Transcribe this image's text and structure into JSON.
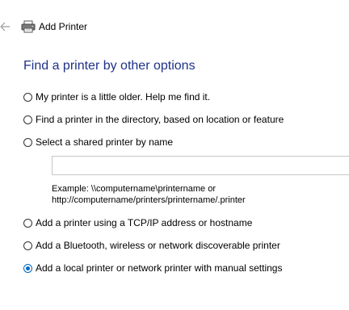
{
  "window": {
    "title": "Add Printer"
  },
  "icons": {
    "back": "back-arrow-icon",
    "printer": "printer-icon"
  },
  "colors": {
    "heading": "#1e3287",
    "radio_selected": "#0067c0"
  },
  "main": {
    "heading": "Find a printer by other options",
    "options": [
      {
        "label": "My printer is a little older. Help me find it.",
        "selected": false
      },
      {
        "label": "Find a printer in the directory, based on location or feature",
        "selected": false
      },
      {
        "label": "Select a shared printer by name",
        "selected": false
      },
      {
        "label": "Add a printer using a TCP/IP address or hostname",
        "selected": false
      },
      {
        "label": "Add a Bluetooth, wireless or network discoverable printer",
        "selected": false
      },
      {
        "label": "Add a local printer or network printer with manual settings",
        "selected": true
      }
    ],
    "shared_printer_input": {
      "value": "",
      "placeholder": ""
    },
    "example_line1": "Example: \\\\computername\\printername or",
    "example_line2": "http://computername/printers/printername/.printer"
  }
}
